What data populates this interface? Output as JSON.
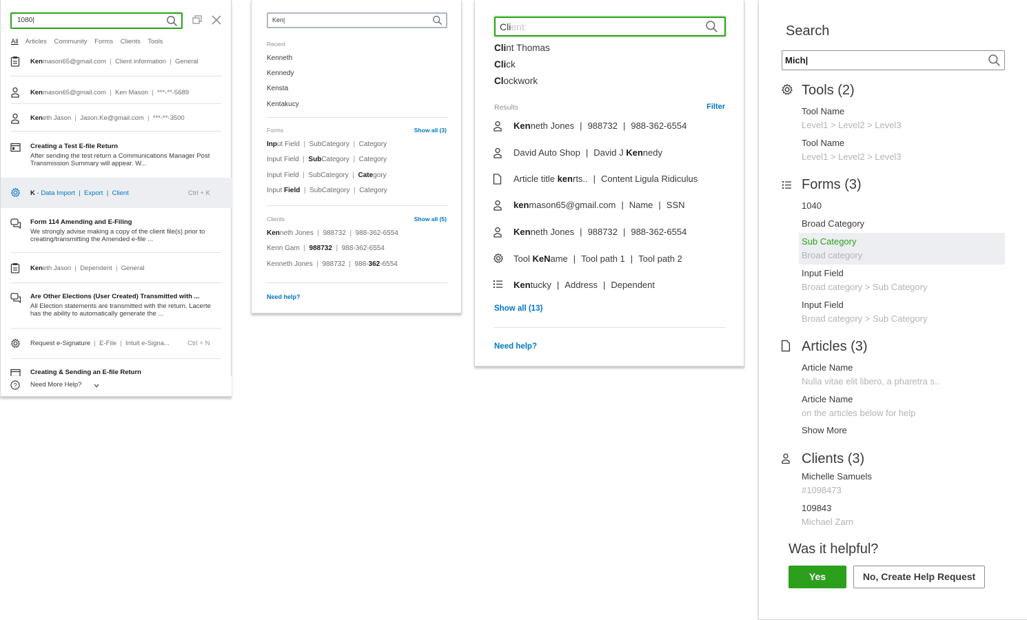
{
  "panel1": {
    "search_value": "1080|",
    "filters": [
      "All",
      "Articles",
      "Community",
      "Forms",
      "Clients",
      "Tools"
    ],
    "rows": [
      {
        "icon": "clipboard-icon",
        "hl": "Ken",
        "rest": "mason65@gmail.com",
        "parts": [
          "Client information",
          "General"
        ]
      },
      {
        "icon": "person-icon",
        "hl": "Ken",
        "rest": "mason65@gmail.com",
        "parts": [
          "Ken Mason",
          "***-**-5689"
        ]
      },
      {
        "icon": "person-icon",
        "hl": "Ken",
        "rest": "eth Jason",
        "parts": [
          "Jason.Ke@gmail.com",
          "***-**-3500"
        ]
      }
    ],
    "article1": {
      "title": "Creating a Test E-file Return",
      "body": "After sending the test return a Communications Manager Post Transmission Summary will appear. W..."
    },
    "tool_row": {
      "hl": "K",
      "rest": " - Data Import",
      "parts": [
        "Export",
        "Client"
      ],
      "shortcut": "Ctrl + K"
    },
    "article2": {
      "title": "Form 114 Amending and E-Filing",
      "body": "We strongly advise making a copy of the client file(s) prior to creating/transmitting the Amended e-file ..."
    },
    "row4": {
      "hl": "Ken",
      "rest": "eth Jason",
      "parts": [
        "Dependent",
        "General"
      ]
    },
    "article3": {
      "title": "Are Other Elections (User Created) Transmitted with ...",
      "body": "All Election statements are transmitted with the return. Lacerte has the ability to automatically generate the ..."
    },
    "tool_row2": {
      "label": "Request e-Signature",
      "parts": [
        "E-File",
        "Intuit e-Signa..."
      ],
      "shortcut": "Ctrl + N"
    },
    "article4": {
      "title": "Creating & Sending an E-file Return"
    },
    "help": "Need More Help?"
  },
  "panel2": {
    "search_value": "Ken|",
    "recent_label": "Recent",
    "recent": [
      "Kenneth",
      "Kennedy",
      "Kensta",
      "Kentakucy"
    ],
    "forms_label": "Forms",
    "forms_show_all": "Show all (3)",
    "clients_label": "Clients",
    "clients_show_all": "Show all (5)",
    "help": "Need help?",
    "form_rows": [
      {
        "a": "Input Field",
        "b": "SubCategory",
        "c": "Category"
      },
      {
        "a": "Input Field",
        "b": "SubCategory",
        "c": "Category"
      },
      {
        "a": "Input Field",
        "b": "SubCategory",
        "c": "Category"
      },
      {
        "a": "Input Field",
        "b": "SubCategory",
        "c": "Category"
      }
    ],
    "client_rows": [
      {
        "a": "Kenneth Jones",
        "b": "988732",
        "c": "988-362-6554"
      },
      {
        "a": "Kenn Gam",
        "b": "988732",
        "c": "988-362-6554"
      },
      {
        "a": "Kenneth Jones",
        "b": "988732",
        "c": "988-362-6554"
      }
    ]
  },
  "panel3": {
    "search_typed": "Cli",
    "search_placeholder": "ent:",
    "suggestions": [
      {
        "hl": "Cli",
        "rest": "nt Thomas"
      },
      {
        "hl": "Cli",
        "rest": "ck"
      },
      {
        "hl": "Cl",
        "rest": "ockwork"
      }
    ],
    "results_label": "Results",
    "filter": "Filter",
    "show_all": "Show all (13)",
    "help": "Need help?"
  },
  "panel4": {
    "title": "Search",
    "search_value": "Mich|",
    "tools": {
      "heading": "Tools (2)",
      "items": [
        {
          "name": "Tool Name",
          "path": "Level1 > Level2 > Level3"
        },
        {
          "name": "Tool Name",
          "path": "Level1 > Level2 > Level3"
        }
      ]
    },
    "forms": {
      "heading": "Forms (3)",
      "items": [
        "1040",
        "Broad Category"
      ],
      "selected": {
        "name": "Sub Category",
        "path": "Broad category"
      },
      "more": [
        {
          "name": "Input Field",
          "path": "Broad category > Sub Category"
        },
        {
          "name": "Input Field",
          "path": "Broad category > Sub Category"
        }
      ]
    },
    "articles": {
      "heading": "Articles (3)",
      "items": [
        {
          "name": "Article Name",
          "path": "Nulla vitae elit libero, a pharetra s.."
        },
        {
          "name": "Article Name",
          "path": "on the articles below for help"
        }
      ],
      "show_more": "Show More"
    },
    "clients": {
      "heading": "Clients (3)",
      "items": [
        {
          "name": "Michelle Samuels",
          "path": "#1098473"
        },
        {
          "name": "109843",
          "path": "Michael Zarn"
        }
      ]
    },
    "helpful": "Was it helpful?",
    "yes": "Yes",
    "no": "No, Create Help Request"
  },
  "colors": {
    "accent_green": "#2ca01c",
    "link_blue": "#0077c5",
    "text": "#393a3d",
    "muted": "#8d9096"
  }
}
